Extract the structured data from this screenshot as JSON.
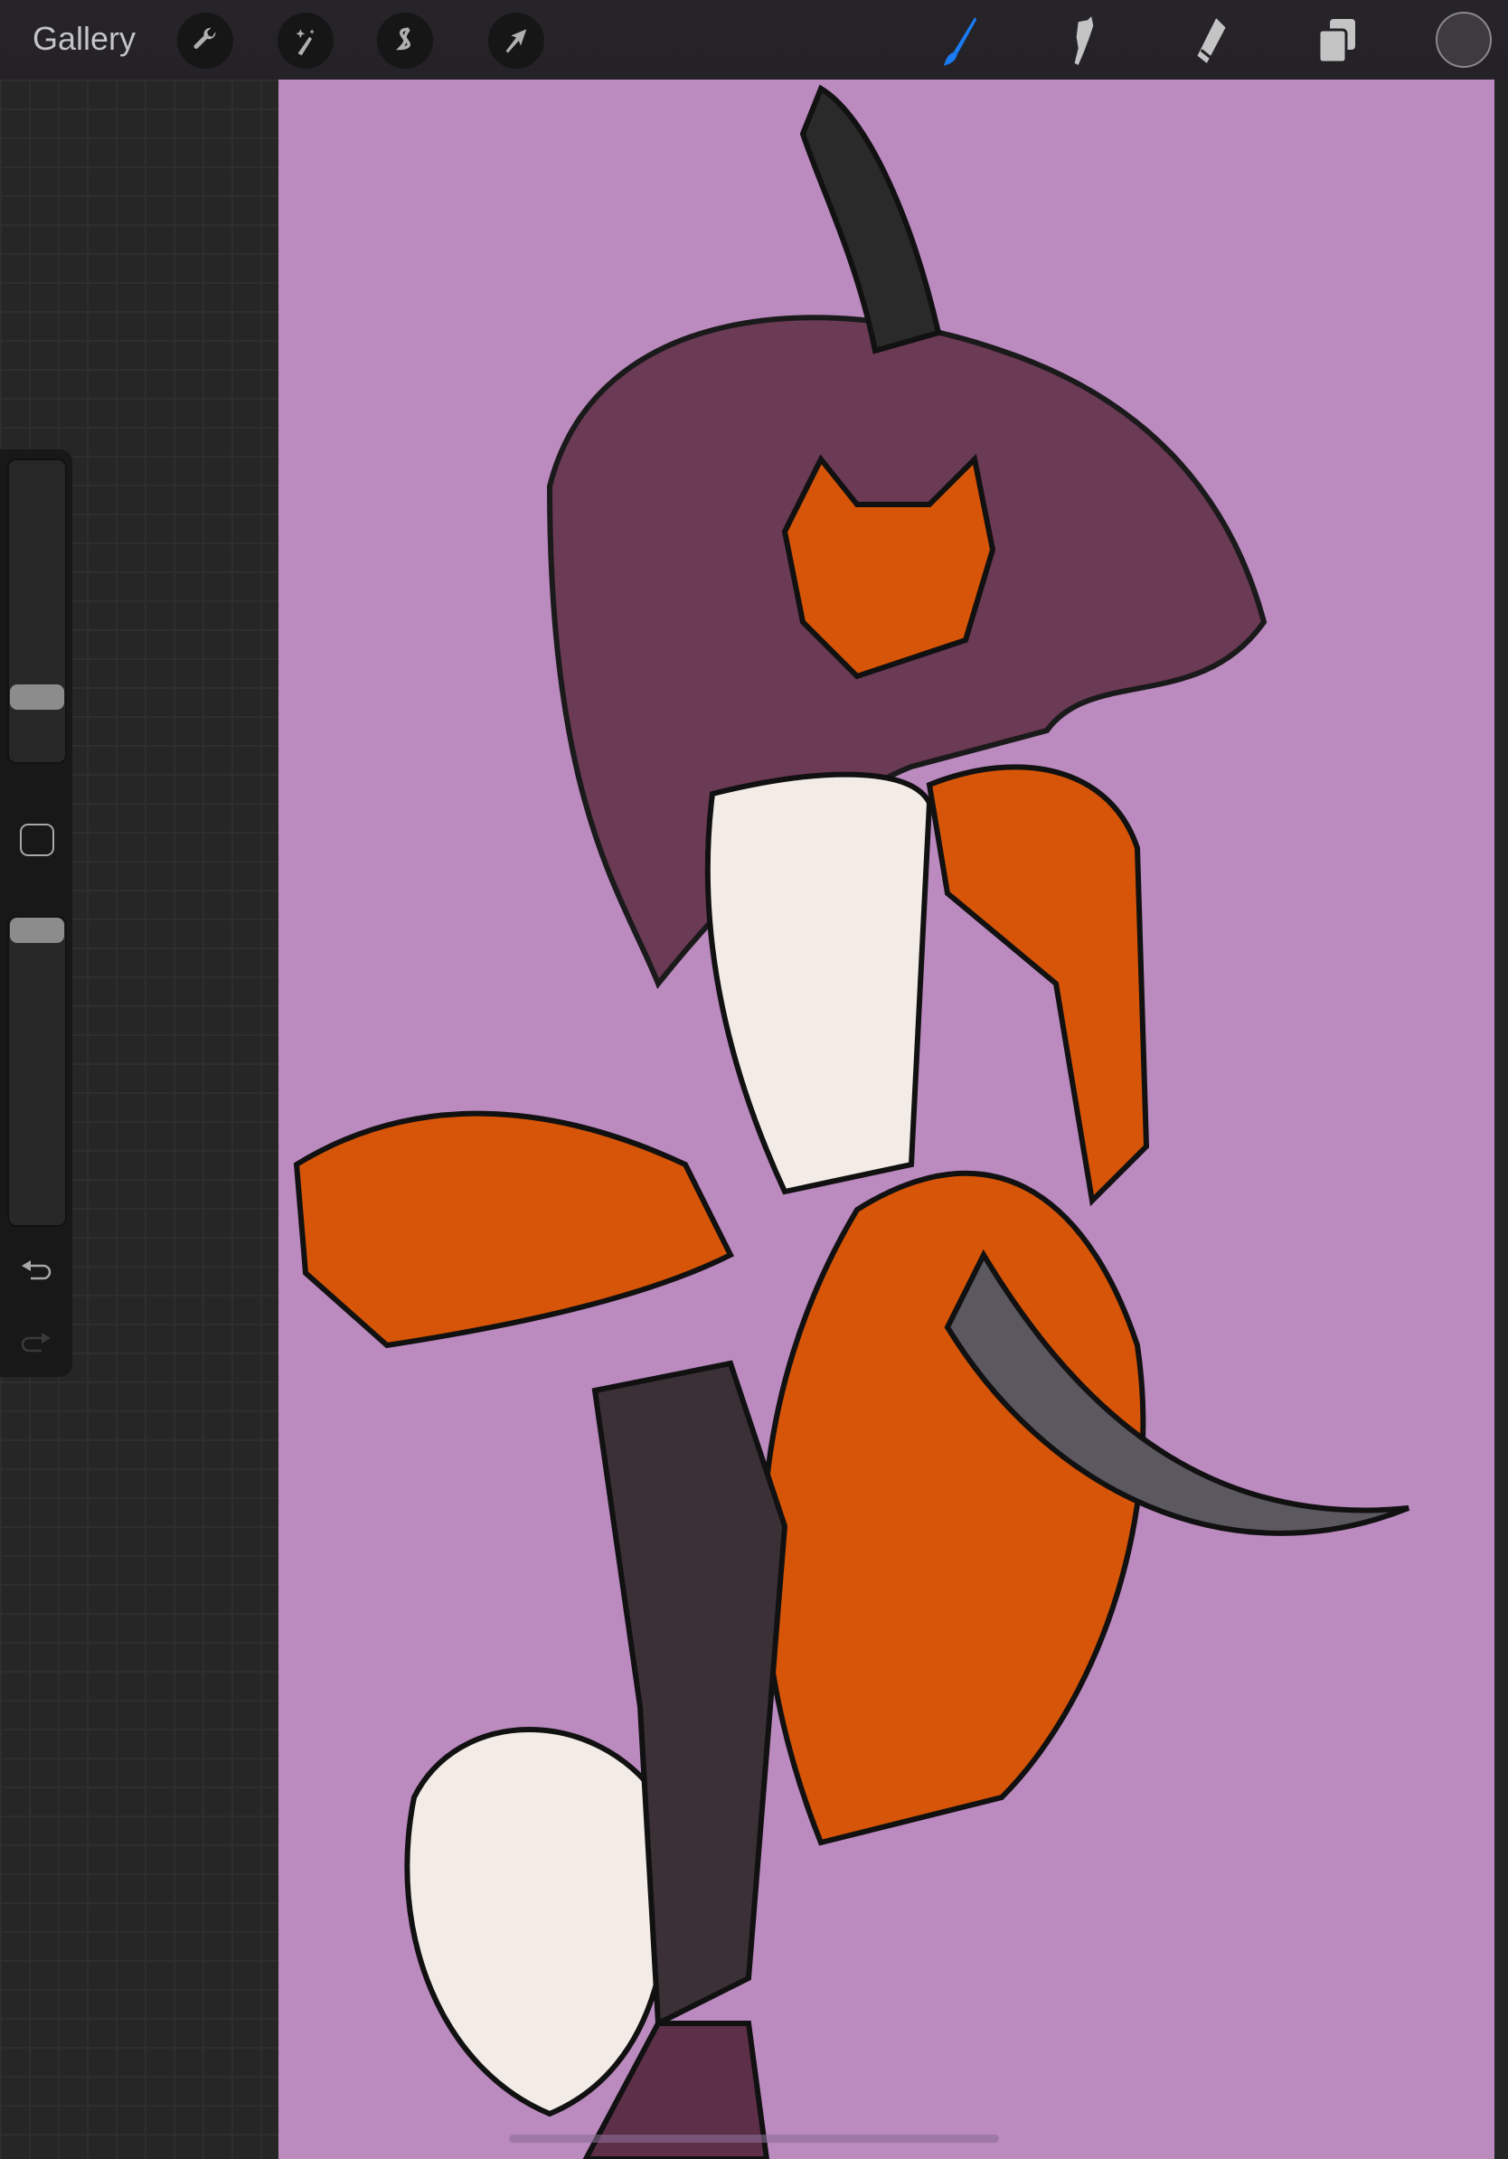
{
  "topbar": {
    "gallery_label": "Gallery",
    "left_tools": [
      "wrench-icon",
      "magic-wand-icon",
      "selection-icon",
      "transform-arrow-icon"
    ],
    "right_tools": [
      "brush-icon",
      "smudge-icon",
      "eraser-icon",
      "layers-icon"
    ],
    "active_tool": "brush",
    "accent_color": "#1a7cf5",
    "current_color": "#3f3a40"
  },
  "sidebar": {
    "brush_size_level": 0.19,
    "opacity_level": 1.0,
    "modify_button": "modify-square-icon",
    "undo": "undo-icon",
    "redo": "redo-icon"
  },
  "canvas": {
    "background_color": "#bb8abf"
  }
}
